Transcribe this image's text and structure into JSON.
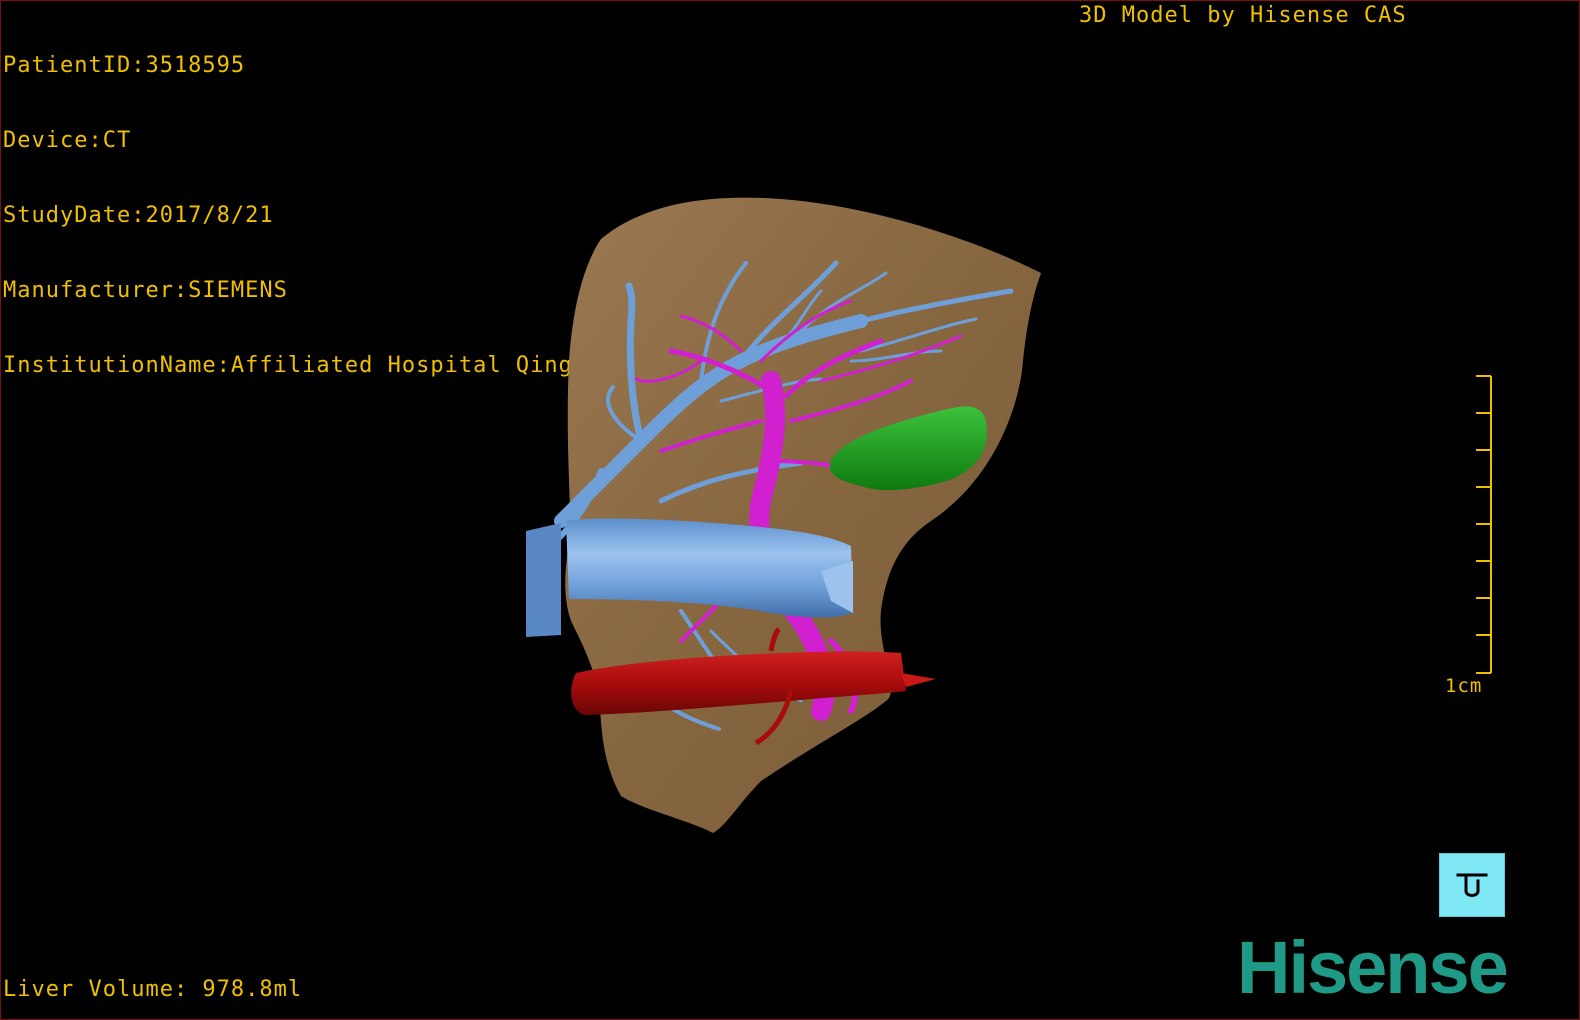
{
  "header": {
    "patient_id": "PatientID:3518595",
    "device": "Device:CT",
    "study_date": "StudyDate:2017/8/21",
    "manufacturer": "Manufacturer:SIEMENS",
    "institution": "InstitutionName:Affiliated Hospital Qingdao University-C"
  },
  "brand_title": "3D Model by Hisense CAS",
  "liver_volume": "Liver Volume: 978.8ml",
  "scale_bar": {
    "label": "1cm"
  },
  "view_button": {
    "icon": "reset-view-icon",
    "glyph": "ᴞ"
  },
  "logo": {
    "text": "Hisense"
  },
  "colors": {
    "text": "#f0c000",
    "liver": "#8a6a47",
    "portal_vein": "#6f9fd8",
    "hepatic_artery": "#d020d0",
    "artery": "#b01010",
    "gallbladder": "#1aa01a",
    "button": "#7fe8f4",
    "logo": "#1e9a86"
  }
}
